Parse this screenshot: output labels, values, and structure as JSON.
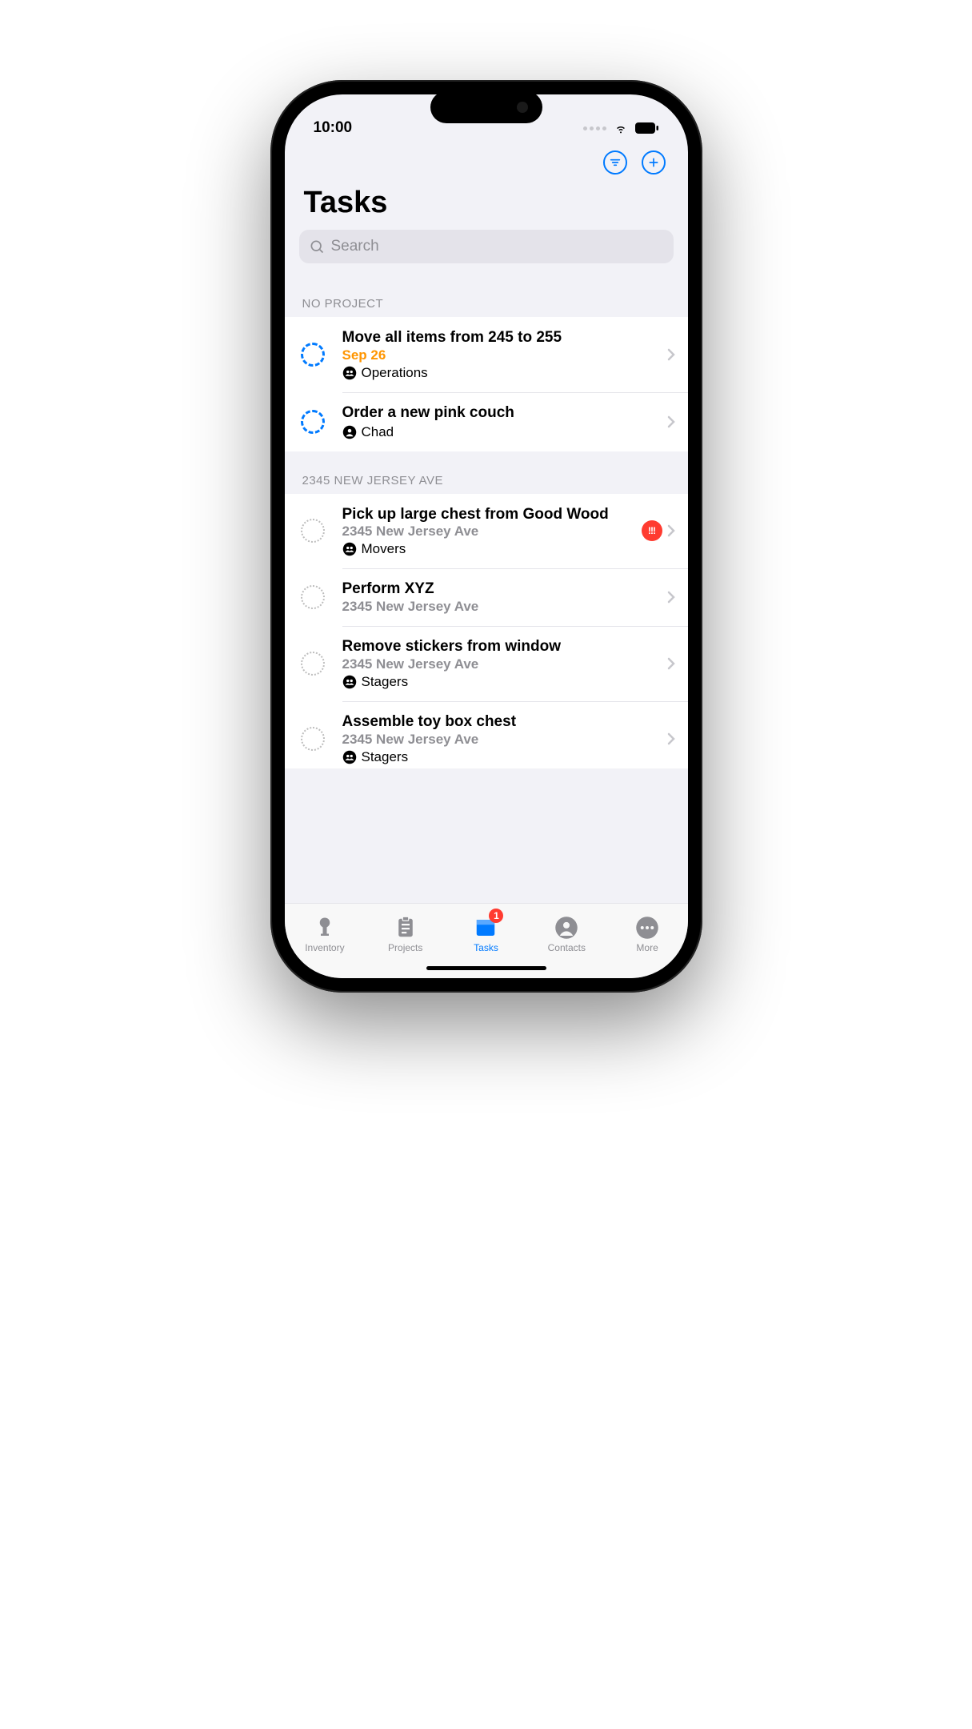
{
  "status_bar": {
    "time": "10:00"
  },
  "header": {
    "title": "Tasks",
    "search_placeholder": "Search"
  },
  "sections": [
    {
      "key": "no_project",
      "header": "NO PROJECT",
      "tasks": [
        {
          "title": "Move all items from 245 to 255",
          "date": "Sep 26",
          "tag_icon": "group",
          "tag_label": "Operations",
          "circle": "blue",
          "priority": false
        },
        {
          "title": "Order a new pink couch",
          "tag_icon": "person",
          "tag_label": "Chad",
          "circle": "blue",
          "priority": false
        }
      ]
    },
    {
      "key": "nj_ave",
      "header": "2345 NEW JERSEY AVE",
      "tasks": [
        {
          "title": "Pick up large chest from Good Wood",
          "subtitle": "2345 New Jersey Ave",
          "tag_icon": "group",
          "tag_label": "Movers",
          "circle": "gray",
          "priority": true
        },
        {
          "title": "Perform XYZ",
          "subtitle": "2345 New Jersey Ave",
          "circle": "gray",
          "priority": false
        },
        {
          "title": "Remove stickers from window",
          "subtitle": "2345 New Jersey Ave",
          "tag_icon": "group",
          "tag_label": "Stagers",
          "circle": "gray",
          "priority": false
        },
        {
          "title": "Assemble toy box chest",
          "subtitle": "2345 New Jersey Ave",
          "tag_icon": "group",
          "tag_label": "Stagers",
          "circle": "gray",
          "priority": false
        }
      ]
    }
  ],
  "tab_bar": {
    "items": [
      {
        "key": "inventory",
        "label": "Inventory",
        "icon": "lamp",
        "active": false
      },
      {
        "key": "projects",
        "label": "Projects",
        "icon": "clipboard",
        "active": false
      },
      {
        "key": "tasks",
        "label": "Tasks",
        "icon": "inbox",
        "active": true,
        "badge": "1"
      },
      {
        "key": "contacts",
        "label": "Contacts",
        "icon": "person-circle",
        "active": false
      },
      {
        "key": "more",
        "label": "More",
        "icon": "ellipsis",
        "active": false
      }
    ]
  },
  "priority_badge_text": "!!!"
}
